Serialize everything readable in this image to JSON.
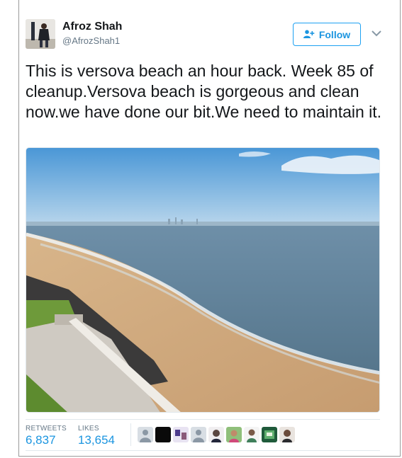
{
  "author": {
    "name": "Afroz Shah",
    "handle": "@AfrozShah1"
  },
  "follow_button": {
    "label": "Follow",
    "icon": "add-user-icon"
  },
  "menu_icon": "chevron-down-icon",
  "tweet": {
    "text": "This is versova beach an hour back. Week 85 of cleanup.Versova beach is gorgeous and clean now.we have done  our bit.We need to maintain it."
  },
  "photo": {
    "subject": "beach-photo"
  },
  "stats": {
    "retweets_label": "RETWEETS",
    "retweets_value": "6,837",
    "likes_label": "LIKES",
    "likes_value": "13,654"
  },
  "likers": [
    {
      "icon": "default-avatar"
    },
    {
      "icon": "black-avatar"
    },
    {
      "icon": "photo-avatar"
    },
    {
      "icon": "default-avatar"
    },
    {
      "icon": "photo-avatar"
    },
    {
      "icon": "photo-avatar"
    },
    {
      "icon": "photo-avatar"
    },
    {
      "icon": "photo-avatar"
    },
    {
      "icon": "photo-avatar"
    }
  ],
  "colors": {
    "accent": "#1b95e0",
    "text": "#14171a",
    "muted": "#657786"
  }
}
